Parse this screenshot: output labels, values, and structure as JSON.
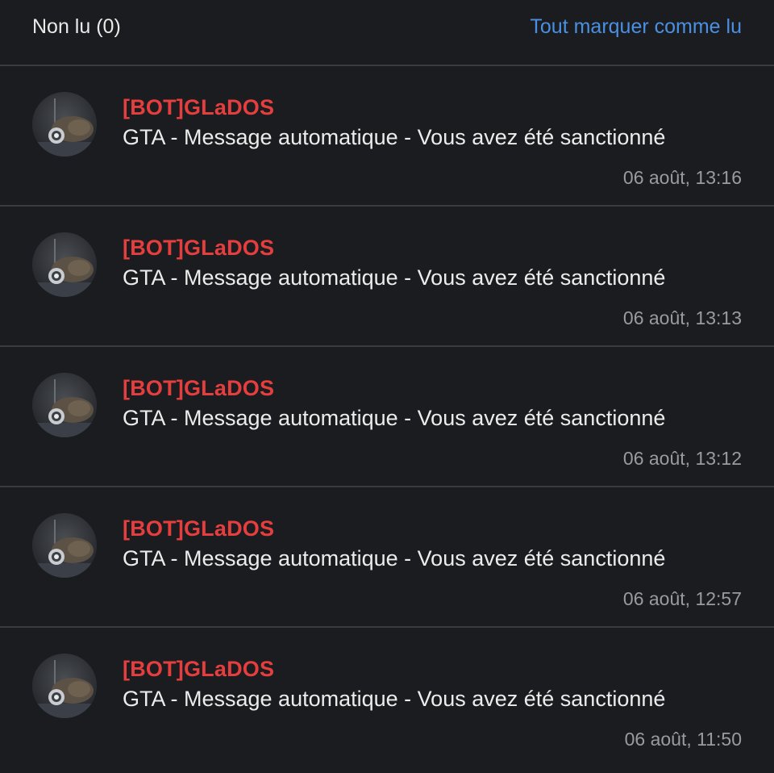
{
  "header": {
    "title": "Non lu (0)",
    "mark_all_label": "Tout marquer comme lu"
  },
  "colors": {
    "background": "#1b1c1f",
    "divider": "#3a3b3f",
    "link": "#4a90e2",
    "sender": "#e53e3e",
    "time": "#9a9b9f"
  },
  "messages": [
    {
      "avatar_icon": "glados-avatar-icon",
      "sender": "[BOT]GLaDOS",
      "subject": "GTA - Message automatique - Vous avez été sanctionné",
      "time": "06 août, 13:16"
    },
    {
      "avatar_icon": "glados-avatar-icon",
      "sender": "[BOT]GLaDOS",
      "subject": "GTA - Message automatique - Vous avez été sanctionné",
      "time": "06 août, 13:13"
    },
    {
      "avatar_icon": "glados-avatar-icon",
      "sender": "[BOT]GLaDOS",
      "subject": "GTA - Message automatique - Vous avez été sanctionné",
      "time": "06 août, 13:12"
    },
    {
      "avatar_icon": "glados-avatar-icon",
      "sender": "[BOT]GLaDOS",
      "subject": "GTA - Message automatique - Vous avez été sanctionné",
      "time": "06 août, 12:57"
    },
    {
      "avatar_icon": "glados-avatar-icon",
      "sender": "[BOT]GLaDOS",
      "subject": "GTA - Message automatique - Vous avez été sanctionné",
      "time": "06 août, 11:50"
    }
  ]
}
